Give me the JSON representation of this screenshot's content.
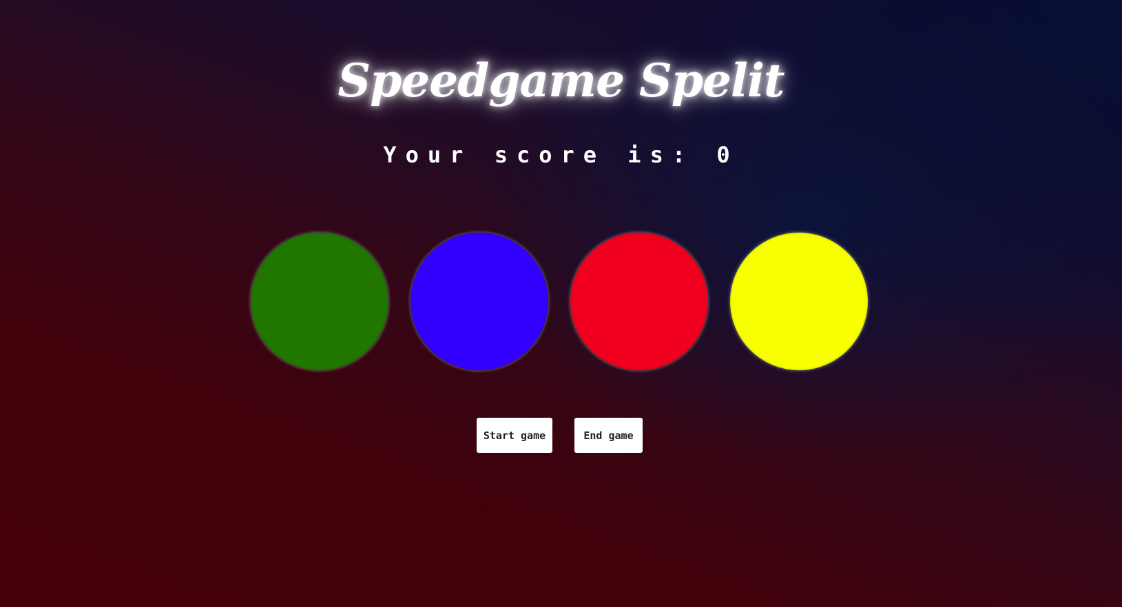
{
  "game": {
    "title": "Speedgame Spelit",
    "score_label": "Your score is:",
    "score_value": "0"
  },
  "circles": [
    {
      "name": "green",
      "color": "#217600"
    },
    {
      "name": "blue",
      "color": "#3300ff"
    },
    {
      "name": "red",
      "color": "#f0001e"
    },
    {
      "name": "yellow",
      "color": "#f8ff00"
    }
  ],
  "controls": {
    "start_label": "Start game",
    "end_label": "End game"
  }
}
